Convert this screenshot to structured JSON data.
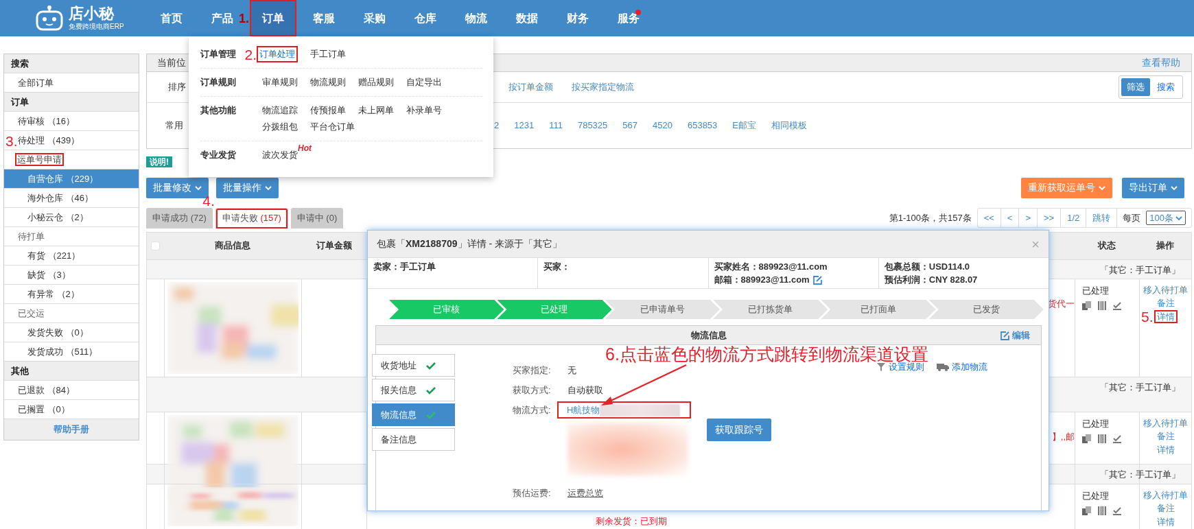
{
  "navbar": {
    "logo": {
      "name": "店小秘",
      "tagline": "免费跨境电商ERP"
    },
    "items": [
      {
        "label": "首页",
        "selected": false,
        "highlighted": false
      },
      {
        "label": "产品",
        "selected": false,
        "highlighted": false
      },
      {
        "label": "订单",
        "selected": true,
        "highlighted": true,
        "annotation": "1."
      },
      {
        "label": "客服",
        "selected": false,
        "highlighted": false
      },
      {
        "label": "采购",
        "selected": false,
        "highlighted": false
      },
      {
        "label": "仓库",
        "selected": false,
        "highlighted": false
      },
      {
        "label": "物流",
        "selected": false,
        "highlighted": false
      },
      {
        "label": "数据",
        "selected": false,
        "highlighted": false
      },
      {
        "label": "财务",
        "selected": false,
        "highlighted": false
      },
      {
        "label": "服务",
        "selected": false,
        "highlighted": false,
        "notification": true
      }
    ]
  },
  "dropdown": {
    "groups": [
      {
        "title": "订单管理",
        "annotation": "2.",
        "links": [
          {
            "label": "订单处理",
            "highlighted": true
          },
          {
            "label": "手工订单",
            "highlighted": false
          }
        ]
      },
      {
        "title": "订单规则",
        "links": [
          {
            "label": "审单规则",
            "highlighted": false
          },
          {
            "label": "物流规则",
            "highlighted": false
          },
          {
            "label": "赠品规则",
            "highlighted": false
          },
          {
            "label": "自定导出",
            "highlighted": false
          }
        ]
      },
      {
        "title": "其他功能",
        "links": [
          {
            "label": "物流追踪",
            "highlighted": false
          },
          {
            "label": "传预报单",
            "highlighted": false
          },
          {
            "label": "未上网单",
            "highlighted": false
          },
          {
            "label": "补录单号",
            "highlighted": false
          },
          {
            "label": "分拨组包",
            "highlighted": false
          },
          {
            "label": "平台仓订单",
            "highlighted": false
          }
        ]
      },
      {
        "title": "专业发货",
        "links": [
          {
            "label": "波次发货",
            "highlighted": false,
            "badge": "Hot"
          }
        ]
      }
    ]
  },
  "sidebar": {
    "sections": [
      {
        "title": "搜索",
        "items": [
          {
            "label": "全部订单",
            "selected": false,
            "highlighted": false
          }
        ]
      },
      {
        "title": "订单",
        "items": [
          {
            "label": "待审核 （16）",
            "selected": false,
            "highlighted": false
          },
          {
            "label": "待处理 （439）",
            "selected": false,
            "highlighted": false,
            "annotation": "3."
          },
          {
            "label": "运单号申请",
            "selected": false,
            "highlighted": true,
            "children": [
              {
                "label": "自营仓库 （229）",
                "selected": true,
                "highlighted": false
              },
              {
                "label": "海外仓库 （46）",
                "selected": false,
                "highlighted": false
              },
              {
                "label": "小秘云仓 （2）",
                "selected": false,
                "highlighted": false
              }
            ]
          },
          {
            "label": "待打单",
            "selected": false,
            "highlighted": false,
            "children": [
              {
                "label": "有货 （221）",
                "selected": false,
                "highlighted": false
              },
              {
                "label": "缺货 （3）",
                "selected": false,
                "highlighted": false
              },
              {
                "label": "有异常 （2）",
                "selected": false,
                "highlighted": false
              }
            ]
          },
          {
            "label": "已交运",
            "selected": false,
            "highlighted": false,
            "children": [
              {
                "label": "发货失败 （0）",
                "selected": false,
                "highlighted": false
              },
              {
                "label": "发货成功 （511）",
                "selected": false,
                "highlighted": false
              }
            ]
          }
        ]
      },
      {
        "title": "其他",
        "items": [
          {
            "label": "已退款 （84）",
            "selected": false,
            "highlighted": false
          },
          {
            "label": "已搁置 （0）",
            "selected": false,
            "highlighted": false
          }
        ]
      }
    ],
    "help_link": "帮助手册"
  },
  "breadcrumb": {
    "label": "当前位",
    "help": "查看帮助"
  },
  "filters": {
    "sort": {
      "label": "排序",
      "options": [
        "按订单金额",
        "按买家指定物流"
      ]
    },
    "view_toggle": [
      {
        "label": "筛选",
        "selected": true
      },
      {
        "label": "搜索",
        "selected": false
      }
    ],
    "common": {
      "label": "常用",
      "options": [
        "2",
        "1231",
        "111",
        "785325",
        "567",
        "4520",
        "653853",
        "E邮宝",
        "相同模板"
      ]
    }
  },
  "notice_badge": "说明!",
  "bulk_buttons": [
    "批量修改",
    "批量操作"
  ],
  "action_buttons": [
    {
      "label": "重新获取运单号",
      "kind": "warning"
    },
    {
      "label": "导出订单",
      "kind": "primary"
    }
  ],
  "tabs": [
    {
      "label": "申请成功",
      "count": "(72)",
      "selected": false,
      "highlighted": false
    },
    {
      "label": "申请失败",
      "count": "(157)",
      "selected": true,
      "highlighted": true,
      "annotation": "4."
    },
    {
      "label": "申请中",
      "count": "(0)",
      "selected": false,
      "highlighted": false
    }
  ],
  "pagination": {
    "summary": "第1-100条，共157条",
    "buttons": [
      "<<",
      "<",
      ">",
      ">>",
      "1/2",
      "跳转"
    ],
    "per_page_label": "每页",
    "per_page": "100条"
  },
  "table": {
    "select_all": {
      "checked": false
    },
    "columns": [
      "商品信息",
      "订单金额",
      "状态",
      "操作"
    ],
    "rows": [
      {
        "source": "「其它：手工订单」",
        "note": "货代一",
        "status": "已处理",
        "actions": [
          {
            "label": "移入待打单",
            "highlighted": false
          },
          {
            "label": "备注",
            "highlighted": false
          },
          {
            "label": "详情",
            "highlighted": true,
            "annotation": "5."
          }
        ]
      },
      {
        "source": "「其它：手工订单」",
        "note": "】,,邮",
        "status": "已处理",
        "actions": [
          {
            "label": "移入待打单",
            "highlighted": false
          },
          {
            "label": "备注",
            "highlighted": false
          },
          {
            "label": "详情",
            "highlighted": false
          }
        ]
      },
      {
        "source": "「其它：手工订单」",
        "remaining": "剩余发货：已到期",
        "status": "已处理",
        "actions": [
          {
            "label": "移入待打单",
            "highlighted": false
          },
          {
            "label": "备注",
            "highlighted": false
          },
          {
            "label": "详情",
            "highlighted": false
          }
        ]
      }
    ]
  },
  "modal": {
    "title": "包裹「**XM2188709**」详情 - 来源于「其它」",
    "close": "×",
    "info": [
      [
        {
          "text": "卖家：手工订单",
          "editable": false
        }
      ],
      [
        {
          "text": "买家：",
          "editable": false
        }
      ],
      [
        {
          "text": "买家姓名：889923@11.com",
          "editable": false
        },
        {
          "text": "邮箱：889923@11.com",
          "editable": true
        }
      ],
      [
        {
          "text": "包裹总额：USD114.0",
          "editable": false
        },
        {
          "text": "预估利润：CNY 828.07",
          "editable": false
        }
      ]
    ],
    "steps": [
      {
        "label": "已审核",
        "done": true
      },
      {
        "label": "已处理",
        "done": true
      },
      {
        "label": "已申请单号",
        "done": false
      },
      {
        "label": "已打拣货单",
        "done": false
      },
      {
        "label": "已打面单",
        "done": false
      },
      {
        "label": "已发货",
        "done": false
      }
    ],
    "panel": {
      "title": "物流信息",
      "edit": "编辑",
      "tabs": [
        {
          "label": "收货地址",
          "checked": true,
          "selected": false
        },
        {
          "label": "报关信息",
          "checked": true,
          "selected": false
        },
        {
          "label": "物流信息",
          "checked": true,
          "selected": true
        },
        {
          "label": "备注信息",
          "checked": false,
          "selected": false
        }
      ],
      "tools": [
        {
          "label": "设置规则",
          "kind": "filter"
        },
        {
          "label": "添加物流",
          "kind": "truck"
        }
      ],
      "fields": [
        {
          "kind": "text",
          "label": "买家指定:",
          "value": "无"
        },
        {
          "kind": "text",
          "label": "获取方式:",
          "value": "自动获取"
        },
        {
          "kind": "method",
          "label": "物流方式:",
          "value": "H航技物",
          "highlighted": true
        },
        {
          "kind": "tracking",
          "button": "获取跟踪号"
        },
        {
          "kind": "link",
          "label": "预估运费:",
          "value": "运费总览"
        }
      ]
    }
  },
  "callout": "6.点击蓝色的物流方式跳转到物流渠道设置"
}
